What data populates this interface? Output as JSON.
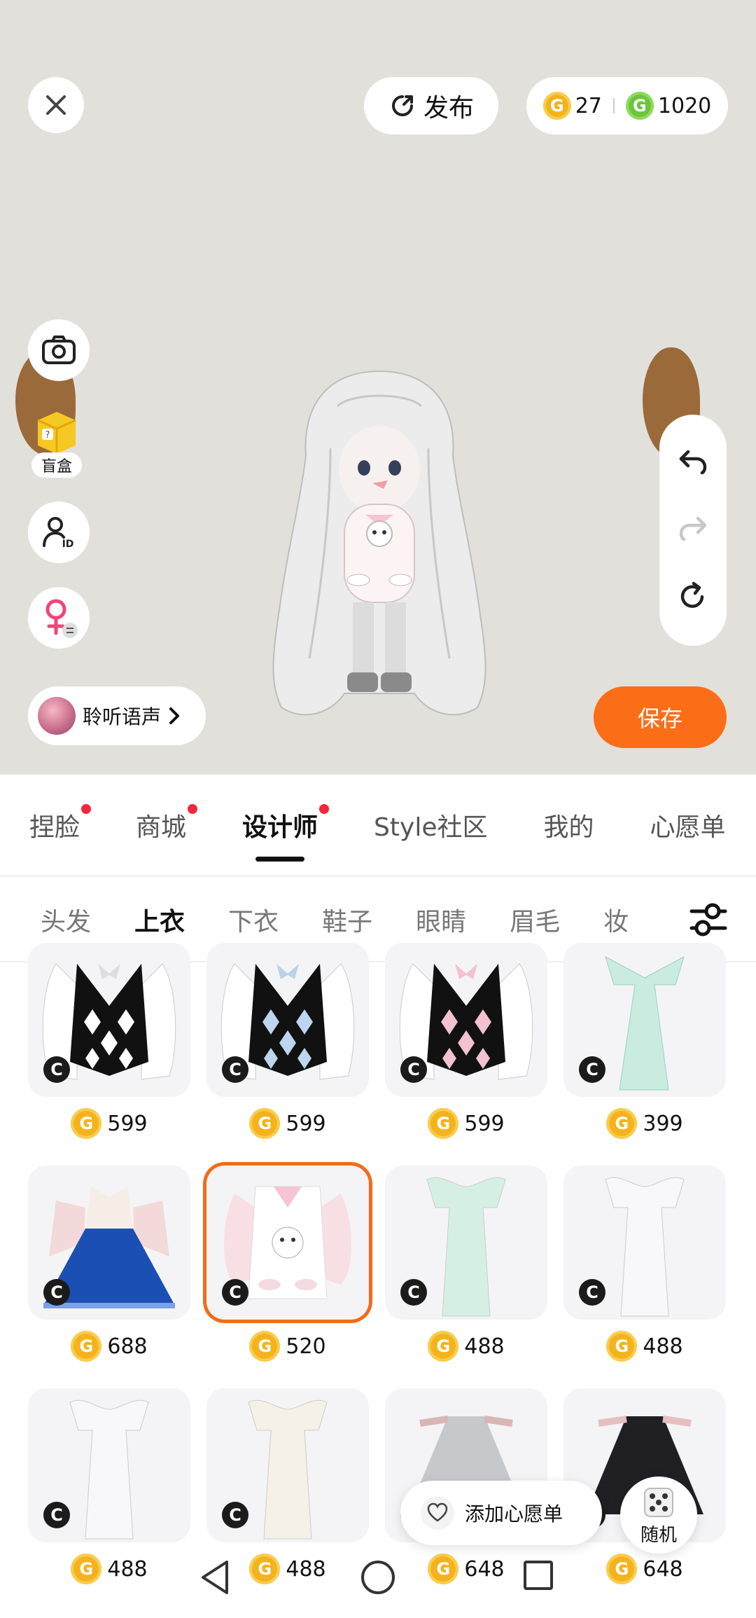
{
  "header": {
    "publish_label": "发布",
    "coins_gold": "27",
    "coins_green": "1020"
  },
  "left_tools": {
    "blindbox_label": "盲盒"
  },
  "voice": {
    "label": "聆听语声"
  },
  "save_label": "保存",
  "tabs": [
    {
      "label": "捏脸",
      "dot": true
    },
    {
      "label": "商城",
      "dot": true
    },
    {
      "label": "设计师",
      "dot": true,
      "active": true
    },
    {
      "label": "Style社区",
      "dot": false
    },
    {
      "label": "我的",
      "dot": false
    },
    {
      "label": "心愿单",
      "dot": false
    }
  ],
  "subtabs": [
    {
      "label": "头发"
    },
    {
      "label": "上衣",
      "active": true
    },
    {
      "label": "下衣"
    },
    {
      "label": "鞋子"
    },
    {
      "label": "眼睛"
    },
    {
      "label": "眉毛"
    },
    {
      "label": "妆"
    }
  ],
  "items": [
    {
      "price": "599",
      "style": "argyle-black"
    },
    {
      "price": "599",
      "style": "argyle-blue"
    },
    {
      "price": "599",
      "style": "argyle-pink"
    },
    {
      "price": "399",
      "style": "dress-mint"
    },
    {
      "price": "688",
      "style": "dress-blue"
    },
    {
      "price": "520",
      "style": "hoodie-pink",
      "selected": true
    },
    {
      "price": "488",
      "style": "gown-green"
    },
    {
      "price": "488",
      "style": "gown-white"
    },
    {
      "price": "488",
      "style": "gown-white"
    },
    {
      "price": "488",
      "style": "gown-ivory"
    },
    {
      "price": "648",
      "style": "dress-grey"
    },
    {
      "price": "648",
      "style": "dress-black"
    }
  ],
  "wishlist_label": "添加心愿单",
  "random_label": "随机",
  "colors": {
    "accent": "#fb6e17",
    "gold_coin": "#f4b31d",
    "green_coin": "#6cc53d",
    "dot": "#f2283a"
  }
}
